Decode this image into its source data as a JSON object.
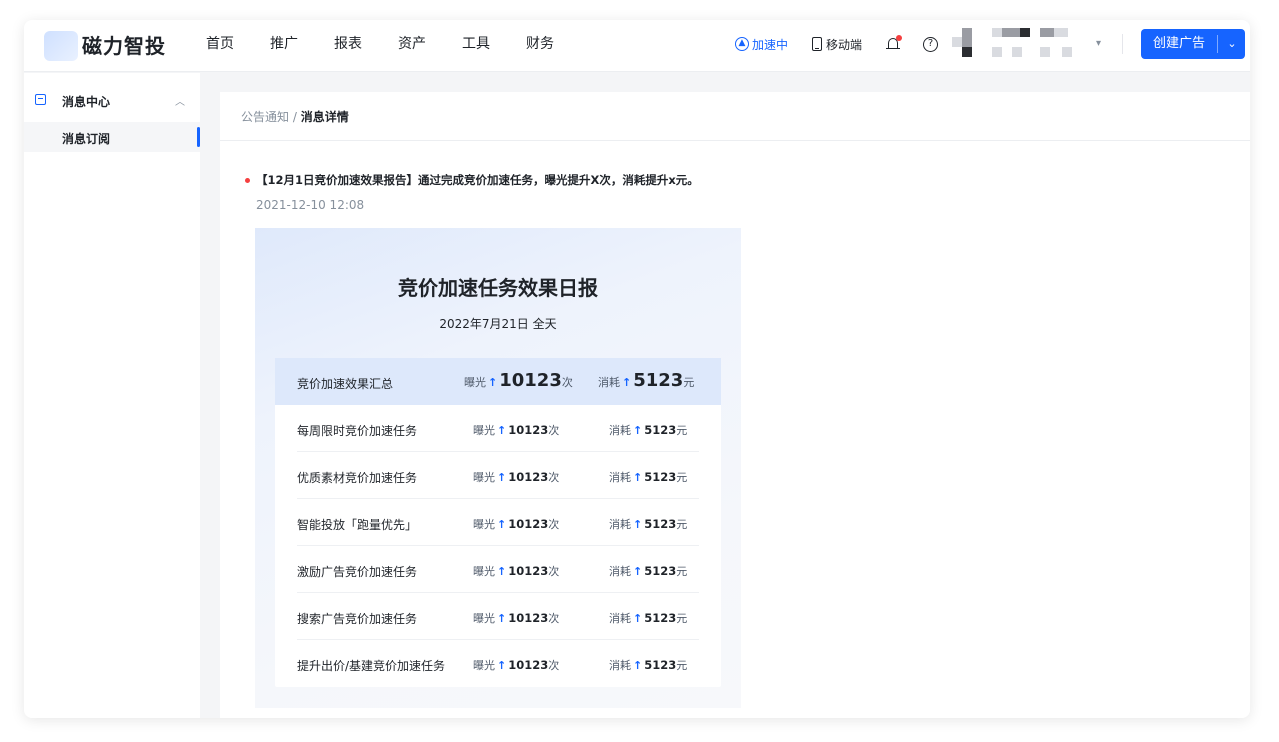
{
  "header": {
    "logo": "磁力智投",
    "nav": [
      "首页",
      "推广",
      "报表",
      "资产",
      "工具",
      "财务"
    ],
    "accelerate": "加速中",
    "mobile": "移动端",
    "create_button": "创建广告"
  },
  "sidebar": {
    "group": "消息中心",
    "item": "消息订阅"
  },
  "breadcrumb": {
    "parent": "公告通知",
    "separator": "/",
    "current": "消息详情"
  },
  "message": {
    "title": "【12月1日竞价加速效果报告】通过完成竞价加速任务，曝光提升X次，消耗提升x元。",
    "time": "2021-12-10 12:08"
  },
  "report": {
    "title": "竞价加速任务效果日报",
    "date": "2022年7月21日 全天",
    "exposure_label": "曝光",
    "cost_label": "消耗",
    "exposure_unit": "次",
    "cost_unit": "元",
    "arrow": "↑",
    "summary": {
      "name": "竞价加速效果汇总",
      "exposure": "10123",
      "cost": "5123"
    },
    "rows": [
      {
        "name": "每周限时竞价加速任务",
        "exposure": "10123",
        "cost": "5123"
      },
      {
        "name": "优质素材竞价加速任务",
        "exposure": "10123",
        "cost": "5123"
      },
      {
        "name": "智能投放「跑量优先」",
        "exposure": "10123",
        "cost": "5123"
      },
      {
        "name": "激励广告竞价加速任务",
        "exposure": "10123",
        "cost": "5123"
      },
      {
        "name": "搜索广告竞价加速任务",
        "exposure": "10123",
        "cost": "5123"
      },
      {
        "name": "提升出价/基建竞价加速任务",
        "exposure": "10123",
        "cost": "5123"
      }
    ]
  },
  "colors": {
    "accent": "#1664ff",
    "alert": "#f53f3f",
    "summary_bg": "#dde8fb"
  },
  "icons": [
    "accelerate-icon",
    "mobile-icon",
    "bell-icon",
    "help-icon",
    "message-center-icon",
    "chevron-up-icon",
    "chevron-down-icon"
  ]
}
